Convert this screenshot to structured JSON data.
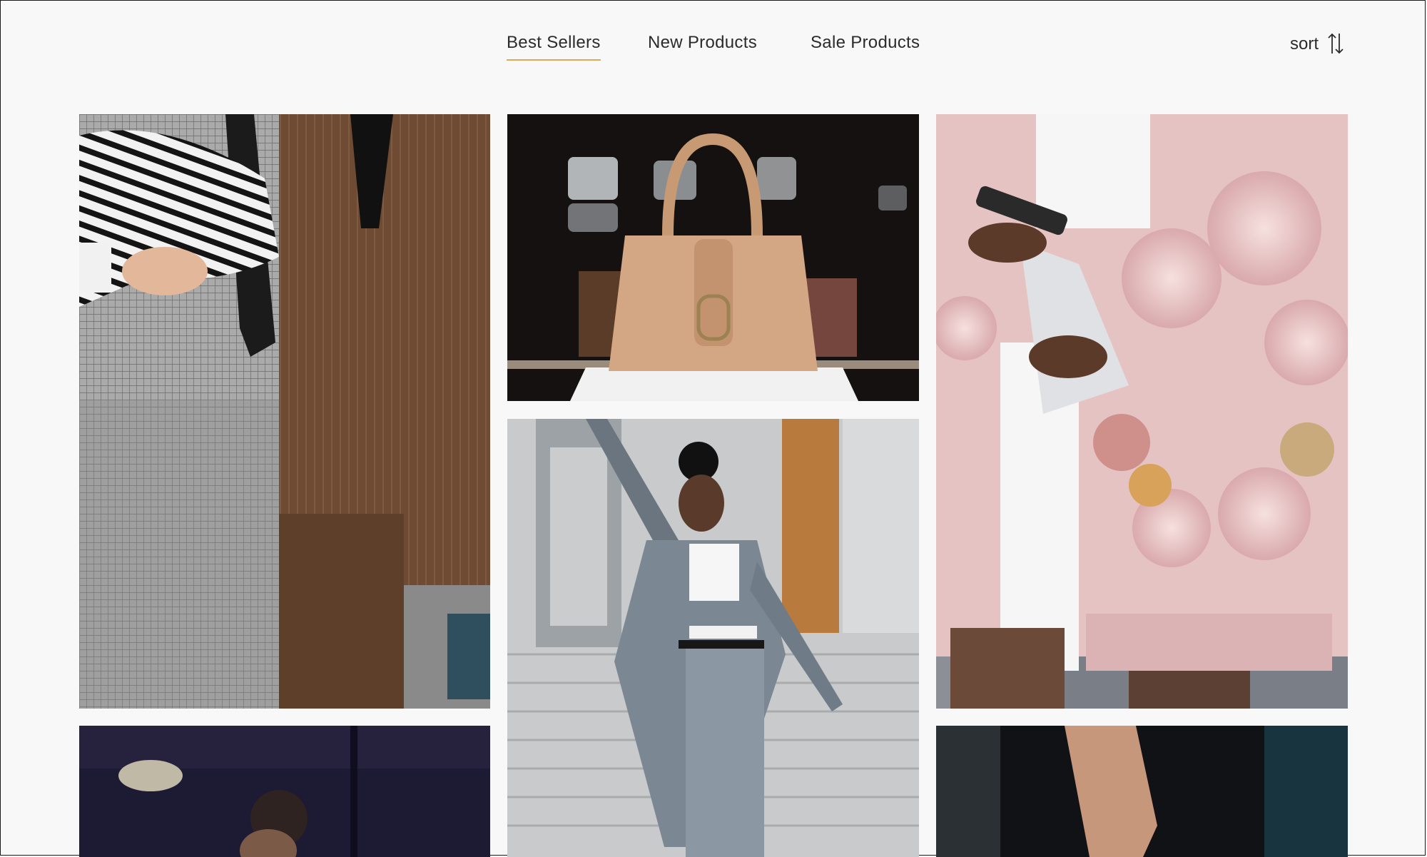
{
  "nav": {
    "tabs": [
      {
        "label": "Best Sellers",
        "active": true
      },
      {
        "label": "New Products",
        "active": false
      },
      {
        "label": "Sale Products",
        "active": false
      }
    ],
    "sort_label": "sort"
  },
  "products": [
    {
      "image": "suits-with-zebra-clutch"
    },
    {
      "image": "tan-leather-handbag"
    },
    {
      "image": "pink-floral-coat-with-phone"
    },
    {
      "image": "woman-grey-suit-stairs"
    },
    {
      "image": "man-dark-interior"
    },
    {
      "image": "arm-black-outfit"
    }
  ],
  "colors": {
    "accent": "#d7ad57",
    "background": "#f8f8f8",
    "text": "#2b2b2b"
  }
}
